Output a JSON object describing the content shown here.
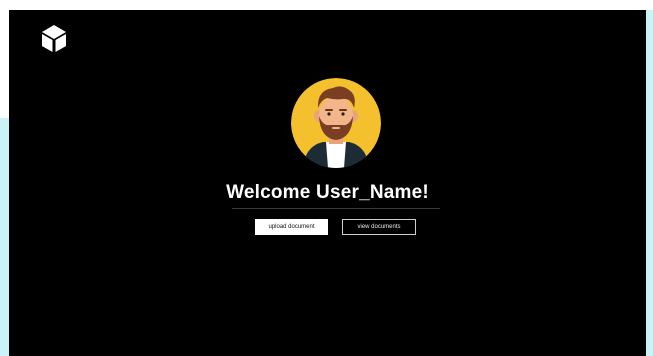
{
  "app": {
    "logo_icon": "cube-icon"
  },
  "main": {
    "avatar_icon": "user-avatar-bearded-man",
    "welcome_text": "Welcome User_Name!",
    "buttons": {
      "upload_label": "upload document",
      "view_label": "view documents"
    }
  },
  "colors": {
    "background": "#000000",
    "avatar_bg": "#f5c02e",
    "accent": "#c9f3f6",
    "text": "#ffffff"
  }
}
